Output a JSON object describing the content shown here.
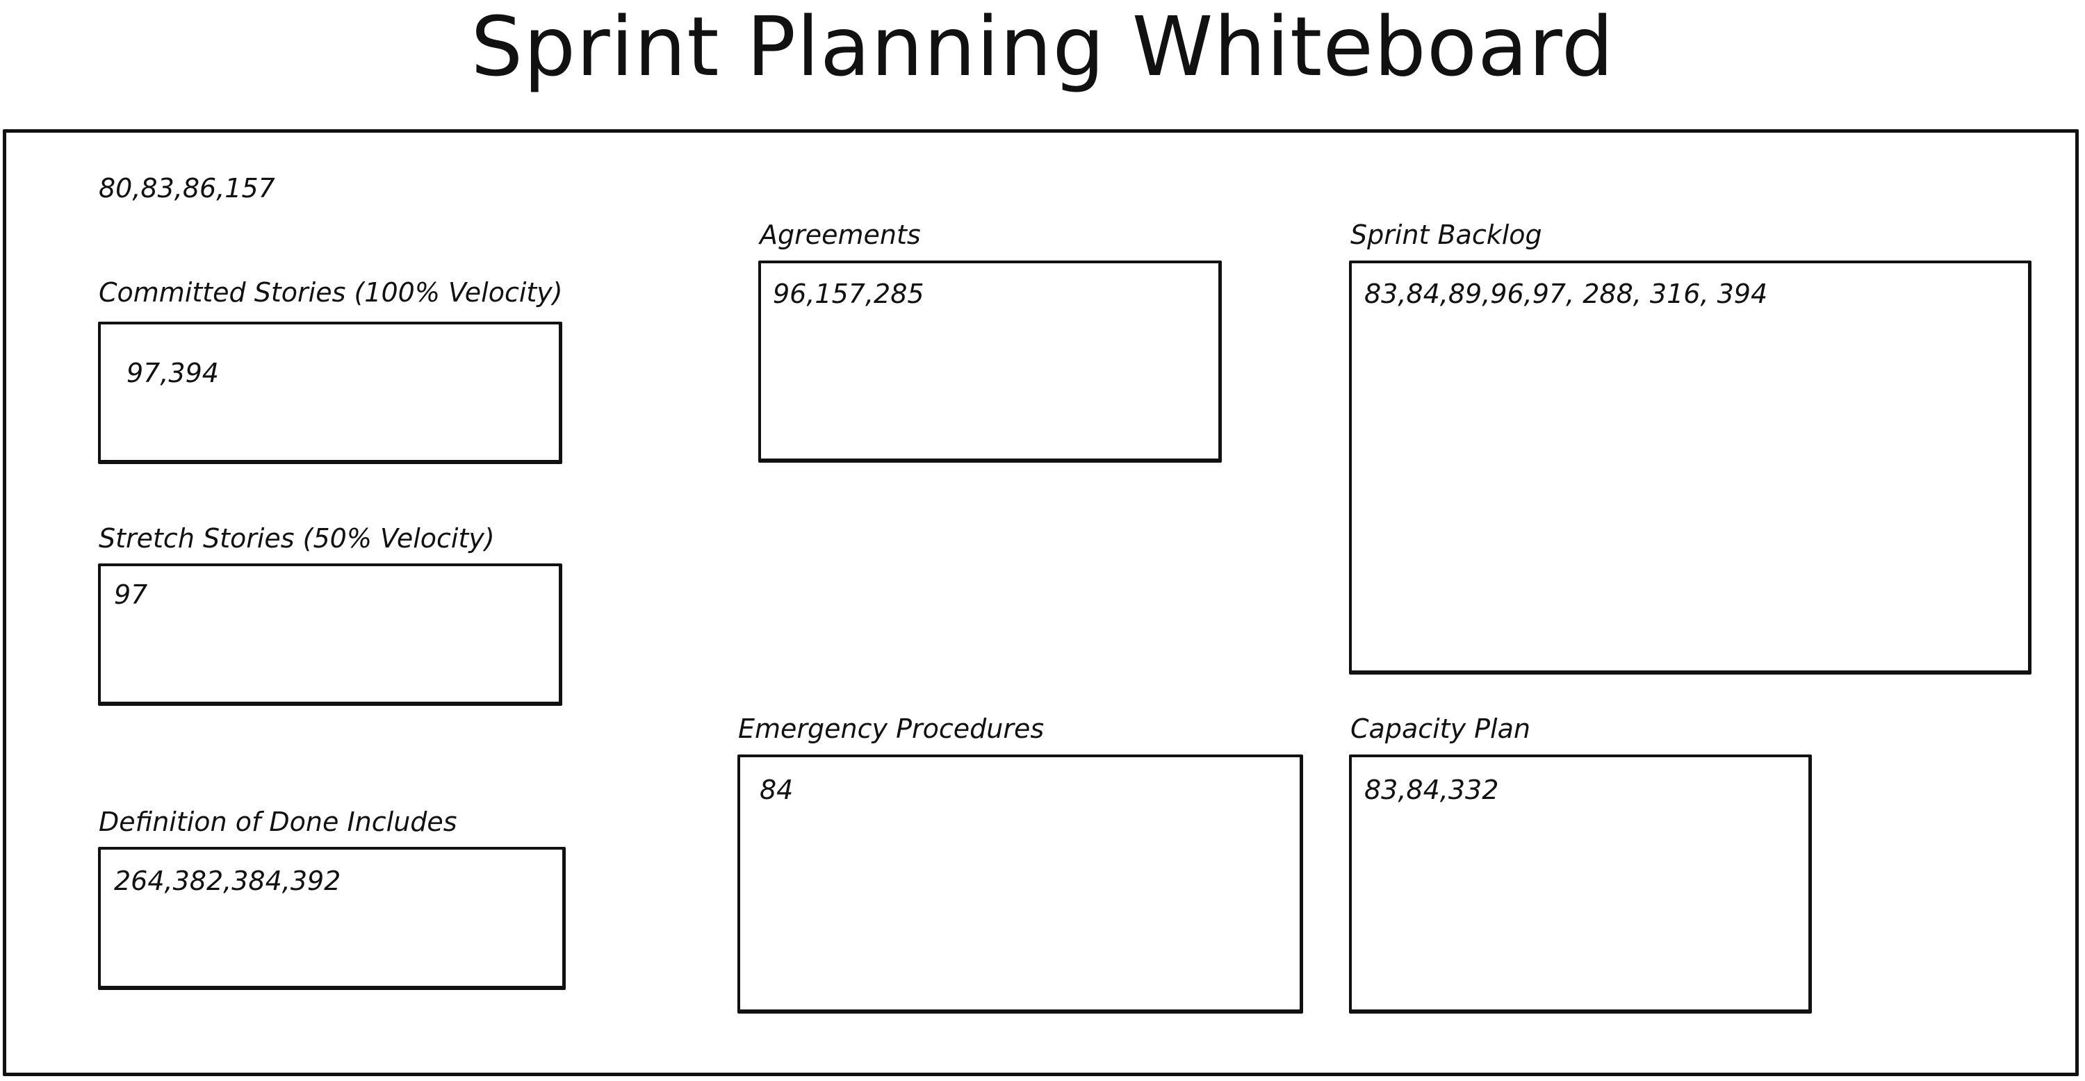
{
  "title": "Sprint Planning Whiteboard",
  "free_note": "80,83,86,157",
  "panels": {
    "committed": {
      "label": "Committed Stories (100% Velocity)",
      "content": "97,394"
    },
    "stretch": {
      "label": "Stretch Stories (50% Velocity)",
      "content": "97"
    },
    "dod": {
      "label": "Definition of Done Includes",
      "content": "264,382,384,392"
    },
    "agreements": {
      "label": "Agreements",
      "content": "96,157,285"
    },
    "emergency": {
      "label": "Emergency Procedures",
      "content": "84"
    },
    "backlog": {
      "label": "Sprint Backlog",
      "content": "83,84,89,96,97, 288, 316, 394"
    },
    "capacity": {
      "label": "Capacity Plan",
      "content": "83,84,332"
    }
  }
}
